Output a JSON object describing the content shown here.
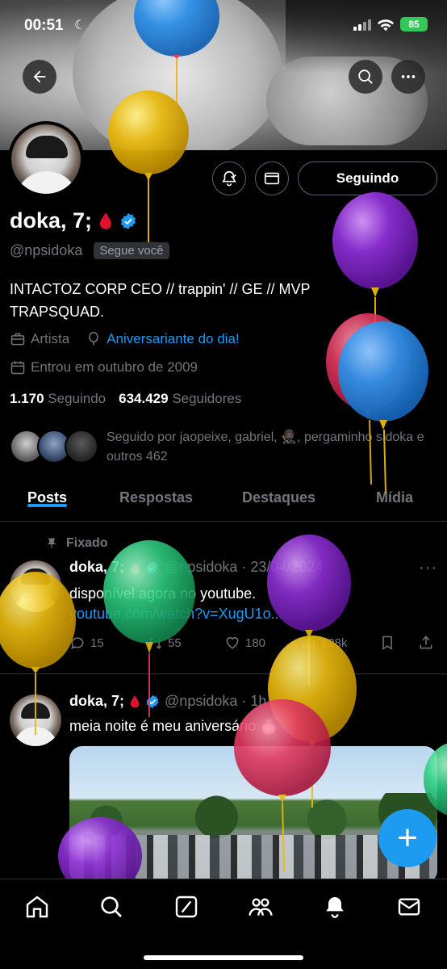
{
  "status": {
    "time": "00:51",
    "battery": "85"
  },
  "profile": {
    "name": "doka, 7;",
    "handle": "@npsidoka",
    "follows_you": "Segue você",
    "bio": "INTACTOZ CORP CEO // trappin' // GE // MVP TRAPSQUAD.",
    "category": "Artista",
    "birthday": "Aniversariante do dia!",
    "joined": "Entrou em outubro de 2009",
    "following_count": "1.170",
    "following_label": "Seguindo",
    "followers_count": "634.429",
    "followers_label": "Seguidores",
    "followed_by": "Seguido por jaopeixe, gabriel, 🥷🏿, pergaminho sidoka e outros 462",
    "follow_button": "Seguindo"
  },
  "tabs": [
    "Posts",
    "Respostas",
    "Destaques",
    "Mídia"
  ],
  "posts": [
    {
      "pinned_label": "Fixado",
      "name": "doka, 7;",
      "handle_date": "@npsidoka · 23/04/2024",
      "text": "disponível agora no youtube.",
      "link": "youtube.com/watch?v=XugU1o...",
      "replies": "15",
      "reposts": "55",
      "likes": "180",
      "views": "128k"
    },
    {
      "name": "doka, 7;",
      "handle_date": "@npsidoka · 1h",
      "text": "meia noite é meu aniversário 🎂"
    }
  ],
  "fab_label": "+",
  "icons": {
    "back": "back-arrow-icon",
    "search": "search-icon",
    "more": "more-icon",
    "bell": "bell-icon",
    "mail": "mail-icon",
    "verified": "verified-badge-icon",
    "blood_drop": "blood-drop-icon"
  },
  "colors": {
    "accent": "#1d9bf0",
    "background": "#000000",
    "muted": "#71767b",
    "balloon_blue": "#2e8fe6",
    "balloon_yellow": "#e8b90f",
    "balloon_purple": "#8e2fd6",
    "balloon_red": "#e23a60",
    "balloon_green": "#2ecf82"
  }
}
